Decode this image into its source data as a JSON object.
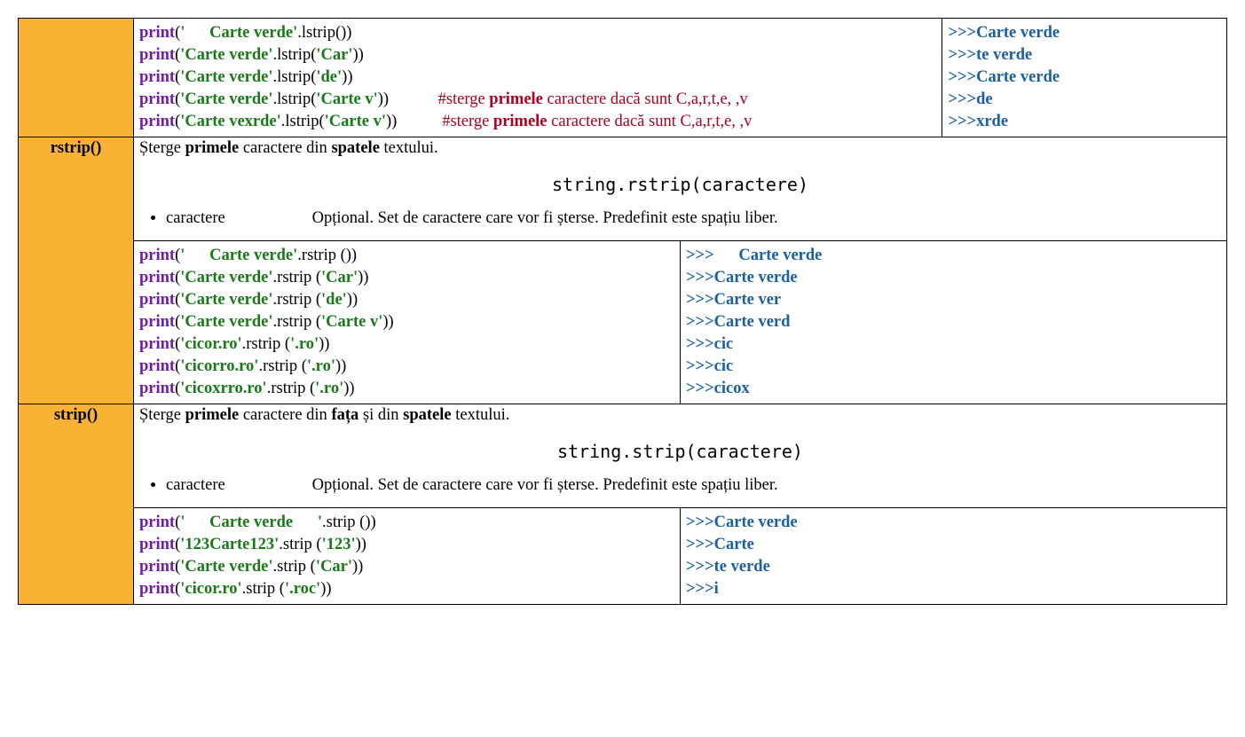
{
  "lstrip": {
    "code": [
      {
        "kw": "print",
        "p1": "(",
        "q1": "'",
        "str": "      Carte verde",
        "q2": "'",
        "call": ".lstrip())"
      },
      {
        "kw": "print",
        "p1": "(",
        "q1": "'",
        "str": "Carte verde",
        "q2": "'",
        "call": ".lstrip(",
        "aq1": "'",
        "arg": "Car",
        "aq2": "'",
        "end": "))"
      },
      {
        "kw": "print",
        "p1": "(",
        "q1": "'",
        "str": "Carte verde",
        "q2": "'",
        "call": ".lstrip(",
        "aq1": "'",
        "arg": "de",
        "aq2": "'",
        "end": "))"
      },
      {
        "kw": "print",
        "p1": "(",
        "q1": "'",
        "str": "Carte verde",
        "q2": "'",
        "call": ".lstrip(",
        "aq1": "'",
        "arg": "Carte v",
        "aq2": "'",
        "end": "))",
        "gap": "            ",
        "cpre": "#sterge ",
        "cb": "primele",
        "cpost": " caractere dacă sunt C,a,r,t,e, ,v"
      },
      {
        "kw": "print",
        "p1": "(",
        "q1": "'",
        "str": "Carte vexrde",
        "q2": "'",
        "call": ".lstrip(",
        "aq1": "'",
        "arg": "Carte v",
        "aq2": "'",
        "end": "))",
        "gap": "           ",
        "cpre": "#sterge ",
        "cb": "primele",
        "cpost": " caractere dacă sunt C,a,r,t,e, ,v"
      }
    ],
    "out": [
      {
        "p": ">>>",
        "b": "Carte verde"
      },
      {
        "p": ">>>",
        "b": "te verde"
      },
      {
        "p": ">>>",
        "b": "Carte verde"
      },
      {
        "p": ">>>",
        "b": "de"
      },
      {
        "p": ">>>",
        "b": "xrde"
      }
    ]
  },
  "rstrip": {
    "label": "rstrip()",
    "desc_pre": "Șterge ",
    "desc_b1": "primele",
    "desc_mid": " caractere din ",
    "desc_b2": "spatele",
    "desc_post": " textului.",
    "syntax": "string.rstrip(caractere)",
    "param_label": "caractere",
    "param_desc": "Opțional. Set de caractere care vor fi șterse. Predefinit este spațiu liber.",
    "code": [
      {
        "kw": "print",
        "p1": "(",
        "q1": "'",
        "str": "      Carte verde",
        "q2": "'",
        "call": ".rstrip ())"
      },
      {
        "kw": "print",
        "p1": "(",
        "q1": "'",
        "str": "Carte verde",
        "q2": "'",
        "call": ".rstrip (",
        "aq1": "'",
        "arg": "Car",
        "aq2": "'",
        "end": "))"
      },
      {
        "kw": "print",
        "p1": "(",
        "q1": "'",
        "str": "Carte verde",
        "q2": "'",
        "call": ".rstrip (",
        "aq1": "'",
        "arg": "de",
        "aq2": "'",
        "end": "))"
      },
      {
        "kw": "print",
        "p1": "(",
        "q1": "'",
        "str": "Carte verde",
        "q2": "'",
        "call": ".rstrip (",
        "aq1": "'",
        "arg": "Carte v",
        "aq2": "'",
        "end": "))"
      },
      {
        "kw": "print",
        "p1": "(",
        "q1": "'",
        "str": "cicor.ro",
        "q2": "'",
        "call": ".rstrip (",
        "aq1": "'",
        "arg": ".ro",
        "aq2": "'",
        "end": "))"
      },
      {
        "kw": "print",
        "p1": "(",
        "q1": "'",
        "str": "cicorro.ro",
        "q2": "'",
        "call": ".rstrip (",
        "aq1": "'",
        "arg": ".ro",
        "aq2": "'",
        "end": "))"
      },
      {
        "kw": "print",
        "p1": "(",
        "q1": "'",
        "str": "cicoxrro.ro",
        "q2": "'",
        "call": ".rstrip (",
        "aq1": "'",
        "arg": ".ro",
        "aq2": "'",
        "end": "))"
      }
    ],
    "out": [
      {
        "p": ">>>",
        "t": "      ",
        "b": "Carte verde"
      },
      {
        "p": ">>>",
        "b": "Carte verde"
      },
      {
        "p": ">>>",
        "b": "Carte ver"
      },
      {
        "p": ">>>",
        "b": "Carte verd"
      },
      {
        "p": ">>>",
        "b": "cic"
      },
      {
        "p": ">>>",
        "b": "cic"
      },
      {
        "p": ">>>",
        "b": "cicox"
      }
    ]
  },
  "strip": {
    "label": "strip()",
    "desc_pre": "Șterge ",
    "desc_b1": "primele",
    "desc_mid1": " caractere din ",
    "desc_b2": "fața",
    "desc_mid2": " și din ",
    "desc_b3": "spatele",
    "desc_post": " textului.",
    "syntax": "string.strip(caractere)",
    "param_label": "caractere",
    "param_desc": "Opțional. Set de caractere care vor fi șterse. Predefinit este spațiu liber.",
    "code": [
      {
        "kw": "print",
        "p1": "(",
        "q1": "'",
        "str": "      Carte verde      ",
        "q2": "'",
        "call": ".strip ())"
      },
      {
        "kw": "print",
        "p1": "(",
        "q1": "'",
        "str": "123Carte123",
        "q2": "'",
        "call": ".strip (",
        "aq1": "'",
        "arg": "123",
        "aq2": "'",
        "end": "))"
      },
      {
        "kw": "print",
        "p1": "(",
        "q1": "'",
        "str": "Carte verde",
        "q2": "'",
        "call": ".strip (",
        "aq1": "'",
        "arg": "Car",
        "aq2": "'",
        "end": "))"
      },
      {
        "kw": "print",
        "p1": "(",
        "q1": "'",
        "str": "cicor.ro",
        "q2": "'",
        "call": ".strip (",
        "aq1": "'",
        "arg": ".roc",
        "aq2": "'",
        "end": "))"
      }
    ],
    "out": [
      {
        "p": ">>>",
        "b": "Carte verde"
      },
      {
        "p": ">>>",
        "b": "Carte"
      },
      {
        "p": ">>>",
        "b": "te verde"
      },
      {
        "p": ">>>",
        "b": "i"
      }
    ]
  }
}
